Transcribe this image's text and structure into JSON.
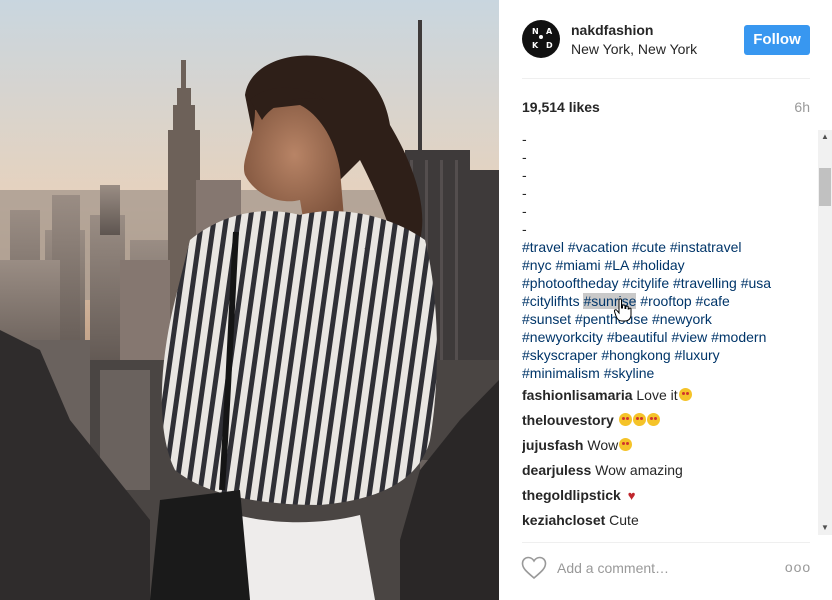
{
  "post": {
    "username": "nakdfashion",
    "location": "New York, New York",
    "follow_label": "Follow",
    "avatar_letters": [
      "N",
      "A",
      "K",
      "D"
    ],
    "likes": "19,514 likes",
    "time": "6h"
  },
  "caption": {
    "dashes": [
      "-",
      "-",
      "-",
      "-",
      "-",
      "-"
    ],
    "tag_lines": [
      [
        "#travel",
        "#vacation",
        "#cute",
        "#instatravel"
      ],
      [
        "#nyc",
        "#miami",
        "#LA",
        "#holiday"
      ],
      [
        "#photooftheday",
        "#citylife",
        "#travelling",
        "#usa"
      ],
      [
        "#citylifhts",
        "#sunrise",
        "#rooftop",
        "#cafe"
      ],
      [
        "#sunset",
        "#penthouse",
        "#newyork"
      ],
      [
        "#newyorkcity",
        "#beautiful",
        "#view",
        "#modern"
      ],
      [
        "#skyscraper",
        "#hongkong",
        "#luxury"
      ],
      [
        "#minimalism",
        "#skyline"
      ]
    ],
    "highlighted_tag": "#sunrise"
  },
  "comments": [
    {
      "user": "fashionlisamaria",
      "text": "Love it",
      "emoji": [
        "heart-eyes"
      ]
    },
    {
      "user": "thelouvestory",
      "text": "",
      "emoji": [
        "heart-eyes",
        "heart-eyes",
        "heart-eyes"
      ]
    },
    {
      "user": "jujusfash",
      "text": "Wow",
      "emoji": [
        "heart-eyes"
      ]
    },
    {
      "user": "dearjuless",
      "text": "Wow amazing",
      "emoji": []
    },
    {
      "user": "thegoldlipstick",
      "text": "",
      "emoji": [
        "red-heart"
      ]
    },
    {
      "user": "keziahcloset",
      "text": "Cute",
      "emoji": []
    }
  ],
  "composer": {
    "placeholder": "Add a comment…",
    "more_label": "ooo"
  },
  "colors": {
    "follow_button": "#3897f0",
    "hashtag": "#003569",
    "highlight": "#c9c9c9",
    "muted": "#999999"
  },
  "icons": {
    "like": "heart-outline-icon",
    "more": "more-options-icon",
    "cursor": "hand-pointer-icon"
  }
}
